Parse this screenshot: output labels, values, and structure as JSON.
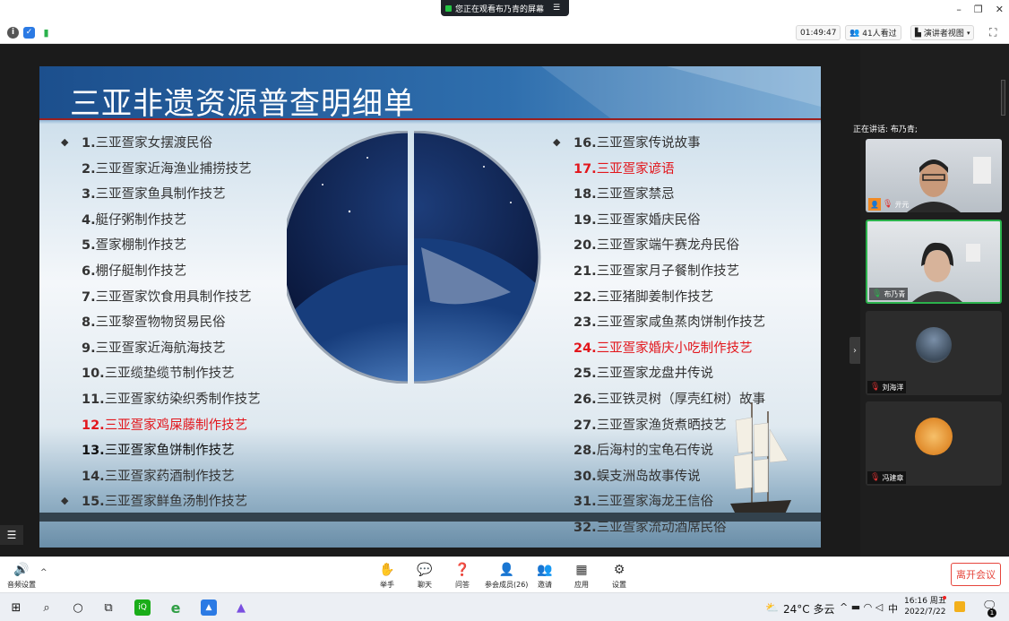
{
  "banner": {
    "text": "您正在观看布乃青的屏幕"
  },
  "topbar": {
    "timer": "01:49:47",
    "viewers": "41人看过",
    "view_mode": "演讲者视图"
  },
  "slide": {
    "title": "三亚非遗资源普查明细单",
    "left_items": [
      {
        "num": "1.",
        "text": "三亚疍家女摆渡民俗"
      },
      {
        "num": "2.",
        "text": "三亚疍家近海渔业捕捞技艺"
      },
      {
        "num": "3.",
        "text": "三亚疍家鱼具制作技艺"
      },
      {
        "num": "4.",
        "text": "艇仔粥制作技艺"
      },
      {
        "num": "5.",
        "text": "疍家棚制作技艺"
      },
      {
        "num": "6.",
        "text": "棚仔艇制作技艺"
      },
      {
        "num": "7.",
        "text": "三亚疍家饮食用具制作技艺"
      },
      {
        "num": "8.",
        "text": "三亚黎疍物物贸易民俗"
      },
      {
        "num": "9.",
        "text": "三亚疍家近海航海技艺"
      },
      {
        "num": "10.",
        "text": "三亚缆垫缆节制作技艺"
      },
      {
        "num": "11.",
        "text": "三亚疍家纺染织秀制作技艺"
      },
      {
        "num": "12.",
        "text": "三亚疍家鸡屎藤制作技艺"
      },
      {
        "num": "13.",
        "text": "三亚疍家鱼饼制作技艺"
      },
      {
        "num": "14.",
        "text": "三亚疍家药酒制作技艺"
      },
      {
        "num": "15.",
        "text": "三亚疍家鲜鱼汤制作技艺"
      }
    ],
    "right_items": [
      {
        "num": "16.",
        "text": "三亚疍家传说故事"
      },
      {
        "num": "17.",
        "text": "三亚疍家谚语"
      },
      {
        "num": "18.",
        "text": "三亚疍家禁忌"
      },
      {
        "num": "19.",
        "text": "三亚疍家婚庆民俗"
      },
      {
        "num": "20.",
        "text": "三亚疍家端午赛龙舟民俗"
      },
      {
        "num": "21.",
        "text": "三亚疍家月子餐制作技艺"
      },
      {
        "num": "22.",
        "text": "三亚猪脚姜制作技艺"
      },
      {
        "num": "23.",
        "text": "三亚疍家咸鱼蒸肉饼制作技艺"
      },
      {
        "num": "24.",
        "text": "三亚疍家婚庆小吃制作技艺"
      },
      {
        "num": "25.",
        "text": "三亚疍家龙盘井传说"
      },
      {
        "num": "26.",
        "text": "三亚铁灵树（厚壳红树）故事"
      },
      {
        "num": "27.",
        "text": "三亚疍家渔货煮晒技艺"
      },
      {
        "num": "28.",
        "text": "后海村的宝龟石传说"
      },
      {
        "num": "30.",
        "text": "蜈支洲岛故事传说"
      },
      {
        "num": "31.",
        "text": "三亚疍家海龙王信俗"
      },
      {
        "num": "32.",
        "text": "三亚疍家流动酒席民俗"
      }
    ],
    "highlight_color": "#e2161c"
  },
  "sidebar": {
    "speaking": "正在讲话: 布乃青;",
    "participants": [
      {
        "name": "亓元"
      },
      {
        "name": "布乃青"
      },
      {
        "name": "刘海洋"
      },
      {
        "name": "冯建章"
      }
    ]
  },
  "toolbar": {
    "audio": "音频设置",
    "buttons": [
      {
        "label": "举手",
        "icon": "hand-icon"
      },
      {
        "label": "聊天",
        "icon": "chat-icon"
      },
      {
        "label": "问答",
        "icon": "qa-icon"
      },
      {
        "label": "参会成员(26)",
        "icon": "participants-icon"
      },
      {
        "label": "邀请",
        "icon": "invite-icon"
      },
      {
        "label": "应用",
        "icon": "apps-icon"
      },
      {
        "label": "设置",
        "icon": "settings-icon"
      }
    ],
    "leave": "离开会议",
    "accent": "#e6453c"
  },
  "taskbar": {
    "weather": "24°C 多云",
    "ime": "中",
    "time": "16:16 周五",
    "date": "2022/7/22",
    "notif_count": "1"
  }
}
